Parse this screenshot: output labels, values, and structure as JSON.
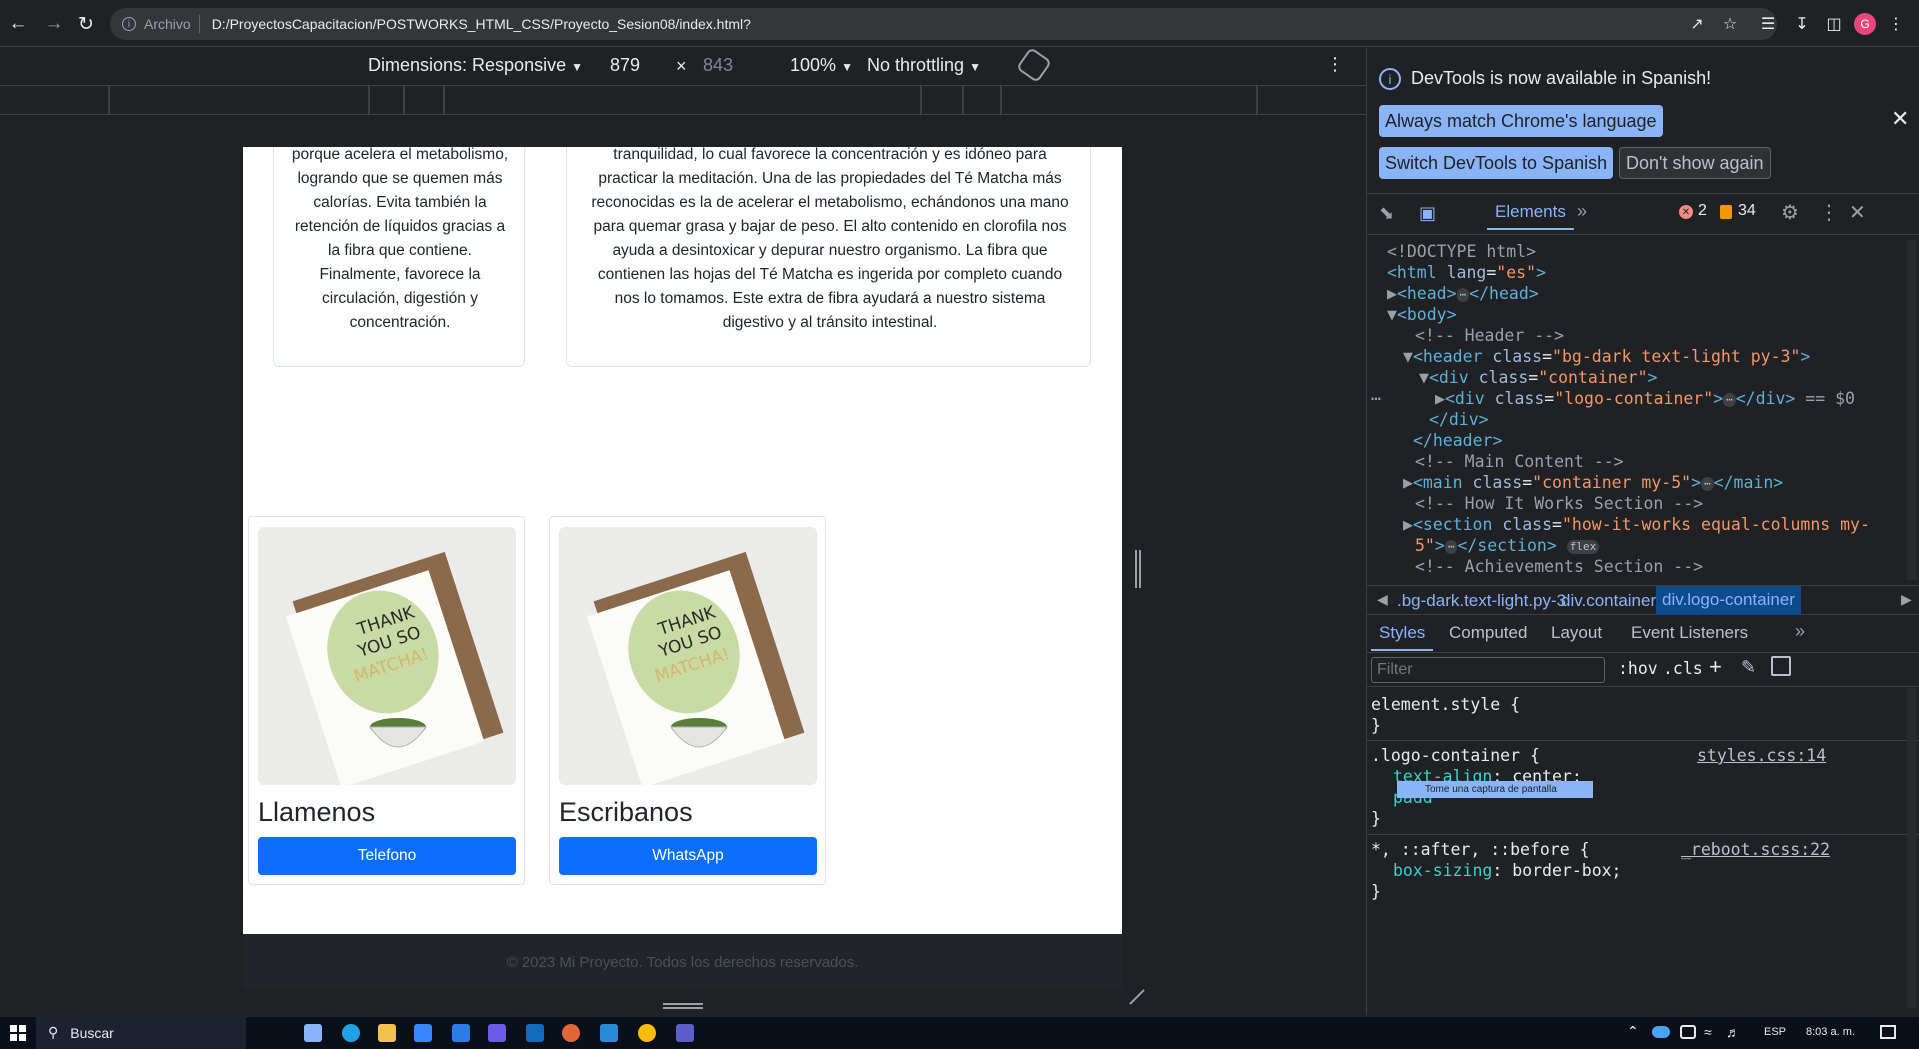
{
  "browser": {
    "archivo_label": "Archivo",
    "url": "D:/ProyectosCapacitacion/POSTWORKS_HTML_CSS/Proyecto_Sesion08/index.html?",
    "profile_initial": "G"
  },
  "device_toolbar": {
    "dimensions": "Dimensions: Responsive",
    "width": "879",
    "times": "×",
    "height": "843",
    "zoom": "100%",
    "throttling": "No throttling"
  },
  "page": {
    "card1_text": "porque acelera el metabolismo, logrando que se quemen más calorías. Evita también la retención de líquidos gracias a la fibra que contiene. Finalmente, favorece la circulación, digestión y concentración.",
    "card2_text": "tranquilidad, lo cual favorece la concentración y es idóneo para practicar la meditación. Una de las propiedades del Té Matcha más reconocidas es la de acelerar el metabolismo, echándonos una mano para quemar grasa y bajar de peso. El alto contenido en clorofila nos ayuda a desintoxicar y depurar nuestro organismo. La fibra que contienen las hojas del Té Matcha es ingerida por completo cuando nos lo tomamos. Este extra de fibra ayudará a nuestro sistema digestivo y al tránsito intestinal.",
    "contacts": [
      {
        "title": "Llamenos",
        "button": "Telefono"
      },
      {
        "title": "Escribanos",
        "button": "WhatsApp"
      }
    ],
    "card_image_text": [
      "THANK",
      "YOU SO",
      "MATCHA!"
    ],
    "footer": "© 2023 Mi Proyecto. Todos los derechos reservados."
  },
  "devtools": {
    "banner": "DevTools is now available in Spanish!",
    "btn_match": "Always match Chrome's language",
    "btn_switch": "Switch DevTools to Spanish",
    "btn_dont_show": "Don't show again",
    "tab_elements": "Elements",
    "errors": "2",
    "warnings": "34",
    "dom": [
      "<!DOCTYPE html>",
      "<!-- Header -->",
      "<!-- Main Content -->",
      "<!-- How It Works Section -->",
      "<!-- Achievements Section -->"
    ],
    "breadcrumbs": [
      ".bg-dark.text-light.py-3",
      "div.container",
      "div.logo-container"
    ],
    "style_tabs": [
      "Styles",
      "Computed",
      "Layout",
      "Event Listeners"
    ],
    "filter_placeholder": "Filter",
    "hov": ":hov",
    "cls": ".cls",
    "rules": {
      "element_style": "element.style {",
      "close": "}",
      "logo_selector": ".logo-container {",
      "logo_source": "styles.css:14",
      "text_align_prop": "text-align",
      "text_align_val": "center;",
      "padding_partial": "padd",
      "tooltip": "Tome una captura de pantalla",
      "universal_selector": "*, ::after, ::before {",
      "universal_source": "_reboot.scss:22",
      "box_sizing_prop": "box-sizing",
      "box_sizing_val": "border-box;"
    }
  },
  "taskbar": {
    "search": "Buscar",
    "lang": "ESP",
    "time": "8:03 a. m."
  }
}
